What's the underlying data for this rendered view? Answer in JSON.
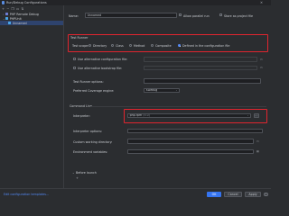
{
  "window": {
    "title": "Run/Debug Configurations"
  },
  "toolbar": {
    "icons": [
      "plus-icon",
      "minus-icon",
      "copy-icon",
      "folder-icon",
      "sort-icon"
    ]
  },
  "tree": {
    "items": [
      {
        "label": "PHP Remote Debug",
        "icon": "php-debug-icon"
      },
      {
        "label": "PHPUnit",
        "icon": "phpunit-icon"
      },
      {
        "label": "Unnamed",
        "icon": "phpunit-icon",
        "selected": true
      }
    ]
  },
  "form": {
    "name_label": "Name:",
    "name_value": "Unnamed",
    "allow_parallel": "Allow parallel run",
    "store_as_project": "Store as project file",
    "test_runner": {
      "section": "Test Runner",
      "test_scope_label": "Test scope:",
      "scopes": [
        "Directory",
        "Class",
        "Method",
        "Composite",
        "Defined in the configuration file"
      ],
      "selected_scope": "Defined in the configuration file"
    },
    "use_alt_config": "Use alternative configuration file:",
    "use_alt_bootstrap": "Use alternative bootstrap file:",
    "test_runner_options": "Test Runner options:",
    "preferred_coverage_label": "Preferred Coverage engine:",
    "preferred_coverage_value": "XDebug",
    "command_line": {
      "section": "Command Line",
      "interpreter_label": "Interpreter:",
      "interpreter_value": "php-fpm",
      "interpreter_version": "(8.0)",
      "interpreter_options": "Interpreter options:",
      "custom_dir": "Custom working directory:",
      "env_vars": "Environment variables:"
    },
    "before_launch": "Before launch"
  },
  "footer": {
    "edit_templates": "Edit configuration templates...",
    "ok": "OK",
    "cancel": "Cancel",
    "apply": "Apply",
    "help": "?"
  },
  "colors": {
    "highlight": "#e0252f",
    "accent": "#3574f0"
  }
}
